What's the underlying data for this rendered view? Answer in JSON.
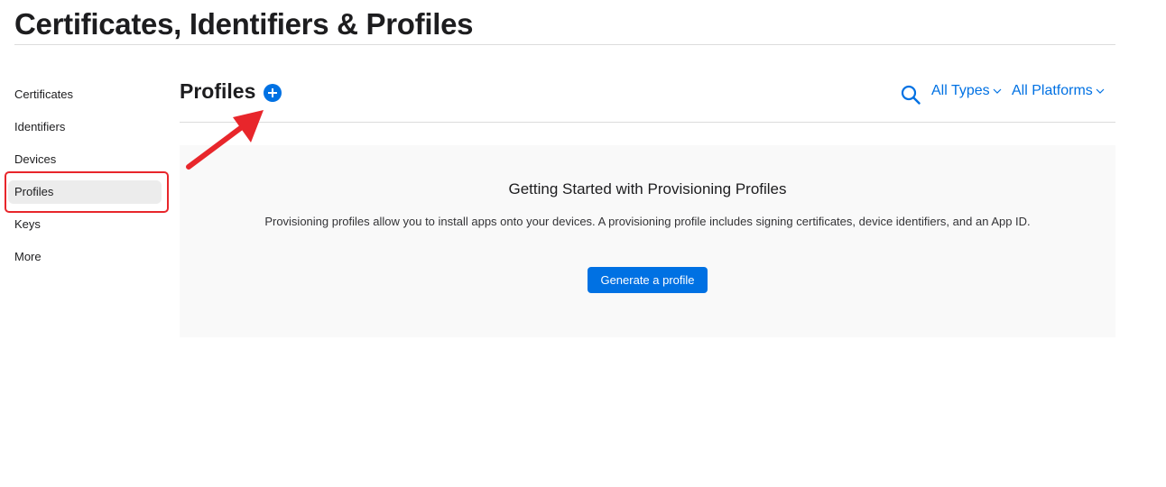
{
  "header": {
    "title": "Certificates, Identifiers & Profiles"
  },
  "sidebar": {
    "items": [
      {
        "label": "Certificates",
        "active": false
      },
      {
        "label": "Identifiers",
        "active": false
      },
      {
        "label": "Devices",
        "active": false
      },
      {
        "label": "Profiles",
        "active": true
      },
      {
        "label": "Keys",
        "active": false
      },
      {
        "label": "More",
        "active": false
      }
    ]
  },
  "main": {
    "section_title": "Profiles",
    "add_icon": "plus-circle-icon",
    "search_icon": "search-icon",
    "filters": {
      "types": {
        "label": "All Types",
        "icon": "chevron-down-icon"
      },
      "platforms": {
        "label": "All Platforms",
        "icon": "chevron-down-icon"
      }
    },
    "empty_state": {
      "title": "Getting Started with Provisioning Profiles",
      "description": "Provisioning profiles allow you to install apps onto your devices. A provisioning profile includes signing certificates, device identifiers, and an App ID.",
      "button_label": "Generate a profile"
    }
  },
  "annotations": {
    "highlight_color": "#e8262b",
    "arrow_icon": "red-arrow-icon"
  },
  "colors": {
    "accent": "#0071e3",
    "text": "#1d1d1f",
    "panel_bg": "#f9f9f9",
    "sidebar_active_bg": "#ececec"
  }
}
